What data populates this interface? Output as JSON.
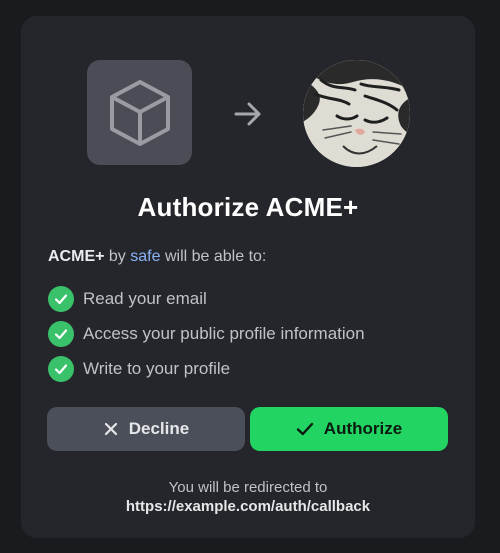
{
  "dialog": {
    "title": "Authorize ACME+",
    "app_name": "ACME+",
    "by_text": "by",
    "org_name": "safe",
    "intro_suffix": "will be able to:",
    "permissions": [
      "Read your email",
      "Access your public profile information",
      "Write to your profile"
    ],
    "decline_label": "Decline",
    "authorize_label": "Authorize",
    "redirect_text": "You will be redirected to",
    "redirect_url": "https://example.com/auth/callback"
  },
  "icons": {
    "app": "cube-icon",
    "arrow": "arrow-right-icon",
    "avatar": "cat-avatar",
    "permission": "check-circle-icon",
    "decline": "close-icon",
    "authorize": "check-icon"
  },
  "colors": {
    "background": "#1a1b1e",
    "card": "#25262b",
    "accent": "#22d462",
    "check": "#3ac26b",
    "link": "#8ab4f8",
    "decline_button": "#4b4f59"
  }
}
